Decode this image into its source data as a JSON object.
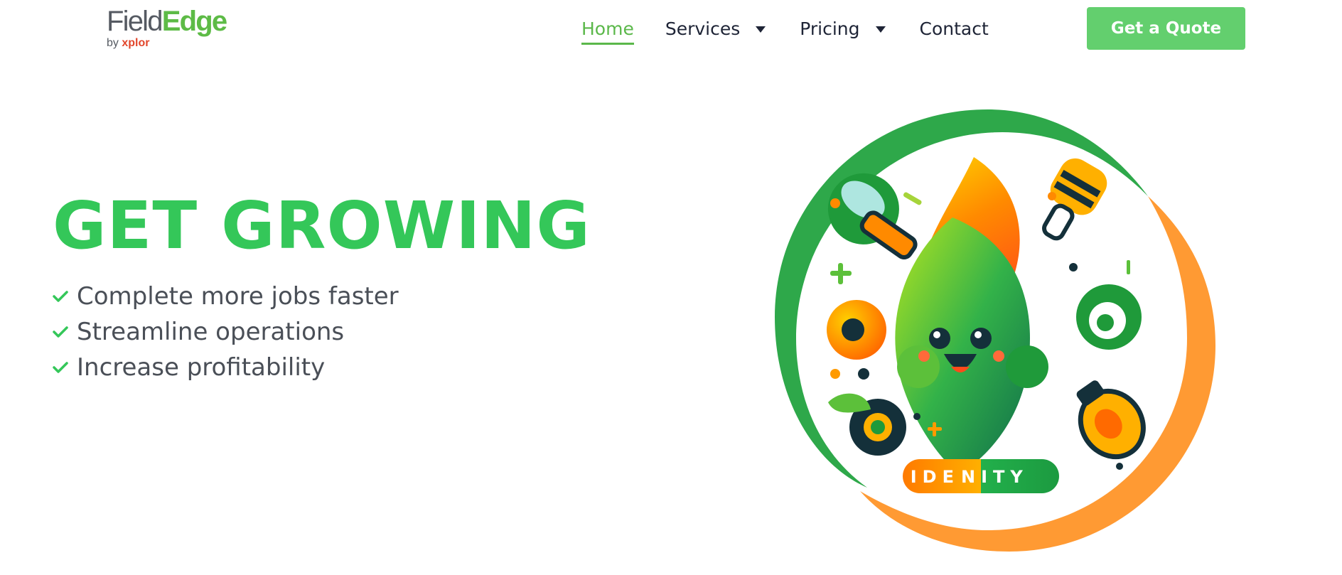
{
  "header": {
    "logo": {
      "field": "Field",
      "edge": "Edge",
      "by": "by",
      "xplor": "xplor"
    },
    "nav": [
      {
        "label": "Home",
        "active": true
      },
      {
        "label": "Services",
        "dropdown": true
      },
      {
        "label": "Pricing",
        "dropdown": true
      },
      {
        "label": "Contact"
      }
    ],
    "cta_label": "Get a Quote"
  },
  "hero": {
    "title": "GET GROWING",
    "bullets": [
      "Complete more jobs faster",
      "Streamline operations",
      "Increase profitability"
    ],
    "illustration": {
      "badge_left": "IDE",
      "badge_right": "NITY"
    }
  },
  "icons": [
    "check-icon",
    "caret-down-icon",
    "wrench-icon",
    "flashlight-icon",
    "lightbulb-icon",
    "gear-icon",
    "leaf-mascot-icon"
  ],
  "colors": {
    "brand_green": "#34c759",
    "nav_active": "#5bb84a",
    "button_green": "#63cf6e",
    "ring_green": "#2ea84a",
    "ring_orange": "#ff9a33",
    "text_dark": "#1e2436",
    "text_gray": "#4a4f57"
  }
}
